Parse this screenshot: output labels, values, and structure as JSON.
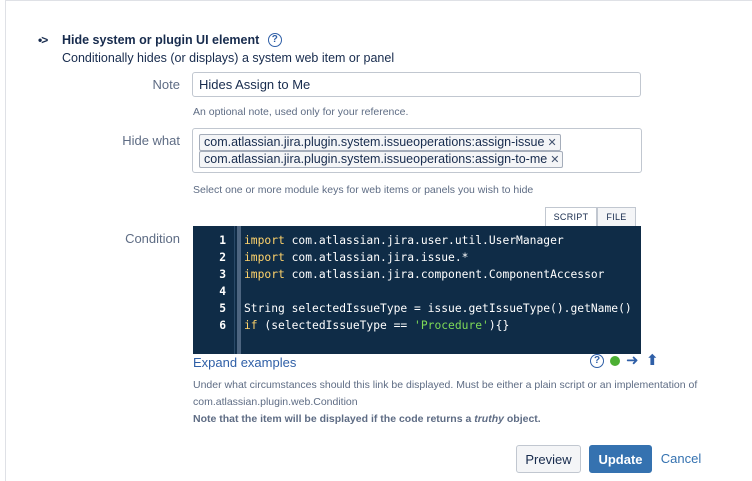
{
  "header": {
    "title": "Hide system or plugin UI element",
    "subtitle": "Conditionally hides (or displays) a system web item or panel"
  },
  "note": {
    "label": "Note",
    "value": "Hides Assign to Me",
    "hint": "An optional note, used only for your reference."
  },
  "hide_what": {
    "label": "Hide what",
    "tags": [
      "com.atlassian.jira.plugin.system.issueoperations:assign-issue",
      "com.atlassian.jira.plugin.system.issueoperations:assign-to-me"
    ],
    "hint": "Select one or more module keys for web items or panels you wish to hide"
  },
  "condition": {
    "label": "Condition",
    "tabs": [
      "SCRIPT",
      "FILE"
    ],
    "active_tab": "SCRIPT",
    "code_lines": [
      {
        "n": "1",
        "kw": "import",
        "rest": " com.atlassian.jira.user.util.UserManager"
      },
      {
        "n": "2",
        "kw": "import",
        "rest": " com.atlassian.jira.issue.*"
      },
      {
        "n": "3",
        "kw": "import",
        "rest": " com.atlassian.jira.component.ComponentAccessor"
      },
      {
        "n": "4",
        "kw": "",
        "rest": ""
      },
      {
        "n": "5",
        "kw": "",
        "rest": "String selectedIssueType = issue.getIssueType().getName()"
      },
      {
        "n": "6",
        "kw": "if",
        "rest": " (selectedIssueType == ",
        "str": "'Procedure'",
        "tail": "){}"
      }
    ],
    "expand_examples": "Expand examples",
    "desc_line1": "Under what circumstances should this link be displayed. Must be either a plain script or an implementation of",
    "desc_line2": "com.atlassian.plugin.web.Condition",
    "note_prefix": "Note that the item will be displayed if the code returns a ",
    "note_em": "truthy",
    "note_suffix": " object."
  },
  "actions": {
    "preview": "Preview",
    "update": "Update",
    "cancel": "Cancel"
  },
  "colors": {
    "accent": "#3572b0",
    "editor_bg": "#0f2c47",
    "keyword": "#ffd36b",
    "string": "#7ed957",
    "status_ok": "#4caf33"
  }
}
